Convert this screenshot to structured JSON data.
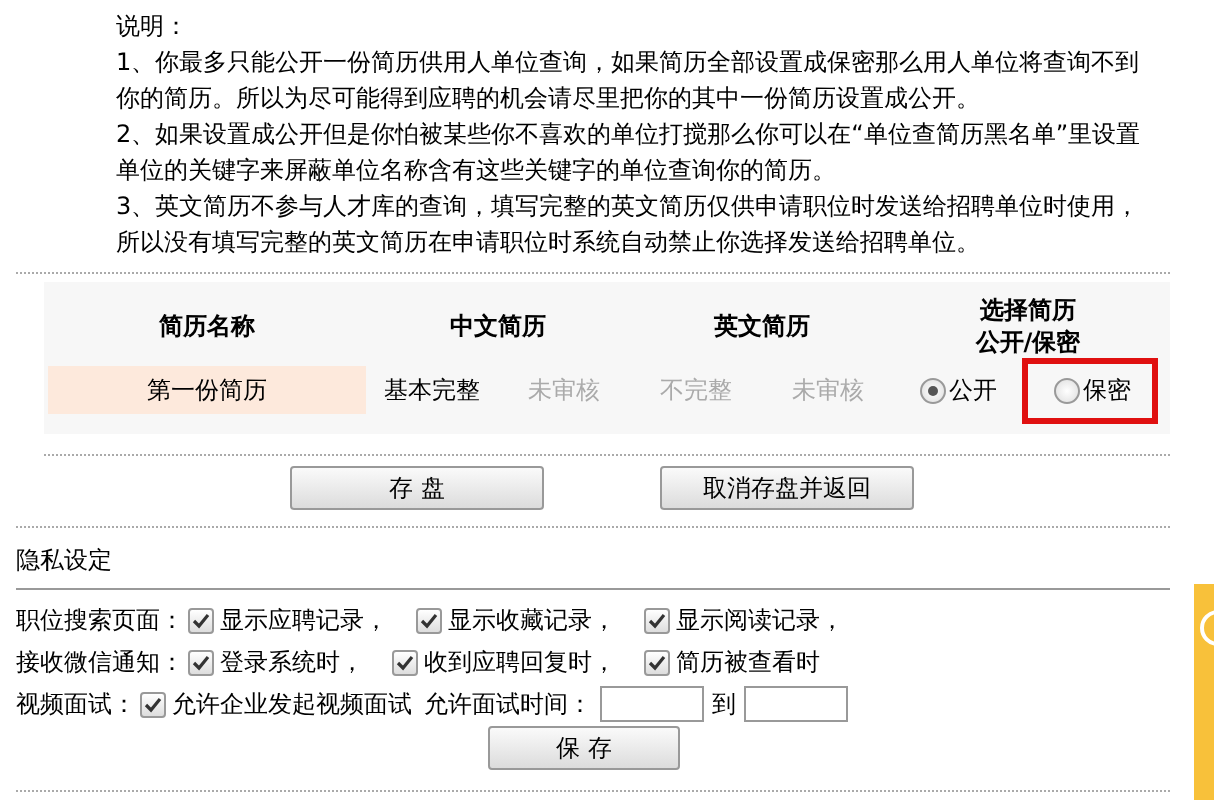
{
  "instructions": {
    "title": "说明：",
    "items": [
      "1、你最多只能公开一份简历供用人单位查询，如果简历全部设置成保密那么用人单位将查询不到你的简历。所以为尽可能得到应聘的机会请尽里把你的其中一份简历设置成公开。",
      "2、如果设置成公开但是你怕被某些你不喜欢的单位打搅那么你可以在“单位查简历黑名单”里设置单位的关键字来屏蔽单位名称含有这些关键字的单位查询你的简历。",
      "3、英文简历不参与人才库的查询，填写完整的英文简历仅供申请职位时发送给招聘单位时使用，所以没有填写完整的英文简历在申请职位时系统自动禁止你选择发送给招聘单位。"
    ]
  },
  "resume_table": {
    "columns": [
      "简历名称",
      "中文简历",
      "英文简历",
      "选择简历公开/保密"
    ],
    "rows": [
      {
        "name": "第一份简历",
        "cells": [
          {
            "text": "基本完整",
            "dimmed": false
          },
          {
            "text": "未审核",
            "dimmed": true
          },
          {
            "text": "不完整",
            "dimmed": true
          },
          {
            "text": "未审核",
            "dimmed": true
          }
        ],
        "options": [
          {
            "label": "公开",
            "selected": true,
            "highlighted": false
          },
          {
            "label": "保密",
            "selected": false,
            "highlighted": true
          }
        ]
      }
    ]
  },
  "buttons": [
    "存 盘",
    "取消存盘并返回"
  ],
  "privacy": {
    "title": "隐私设定",
    "rows": [
      {
        "kind": "checks",
        "label": "职位搜索页面：",
        "options": [
          {
            "label": "显示应聘记录，",
            "checked": true
          },
          {
            "label": "显示收藏记录，",
            "checked": true
          },
          {
            "label": "显示阅读记录，",
            "checked": true
          }
        ]
      },
      {
        "kind": "checks",
        "label": "接收微信通知：",
        "options": [
          {
            "label": "登录系统时，",
            "checked": true
          },
          {
            "label": "收到应聘回复时，",
            "checked": true
          },
          {
            "label": "简历被查看时",
            "checked": true
          }
        ]
      },
      {
        "kind": "video",
        "label": "视频面试：",
        "options": [
          {
            "label": "允许企业发起视频面试",
            "checked": true
          }
        ],
        "time_label": "允许面试时间：",
        "to_label": "到"
      }
    ],
    "save_button": "保 存"
  }
}
